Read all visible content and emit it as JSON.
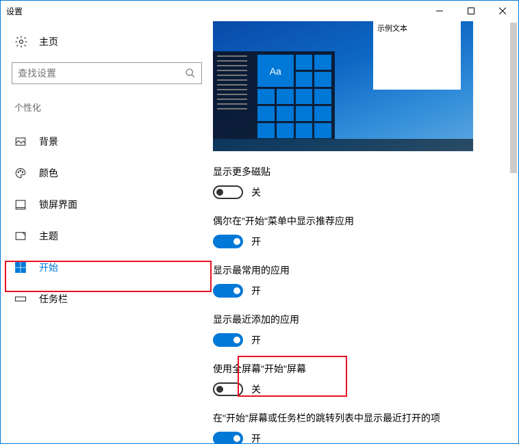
{
  "window": {
    "title": "设置"
  },
  "home": "主页",
  "search": {
    "placeholder": "查找设置"
  },
  "section": "个性化",
  "nav": {
    "background": "背景",
    "colors": "颜色",
    "lockscreen": "锁屏界面",
    "themes": "主题",
    "start": "开始",
    "taskbar": "任务栏"
  },
  "preview": {
    "popup_text": "示例文本",
    "tile_text": "Aa"
  },
  "settings": {
    "s1": {
      "label": "显示更多磁贴",
      "state": "关"
    },
    "s2": {
      "label": "偶尔在\"开始\"菜单中显示推荐应用",
      "state": "开"
    },
    "s3": {
      "label": "显示最常用的应用",
      "state": "开"
    },
    "s4": {
      "label": "显示最近添加的应用",
      "state": "开"
    },
    "s5": {
      "label": "使用全屏幕\"开始\"屏幕",
      "state": "关"
    },
    "s6": {
      "label": "在\"开始\"屏幕或任务栏的跳转列表中显示最近打开的项",
      "state": "开"
    }
  }
}
